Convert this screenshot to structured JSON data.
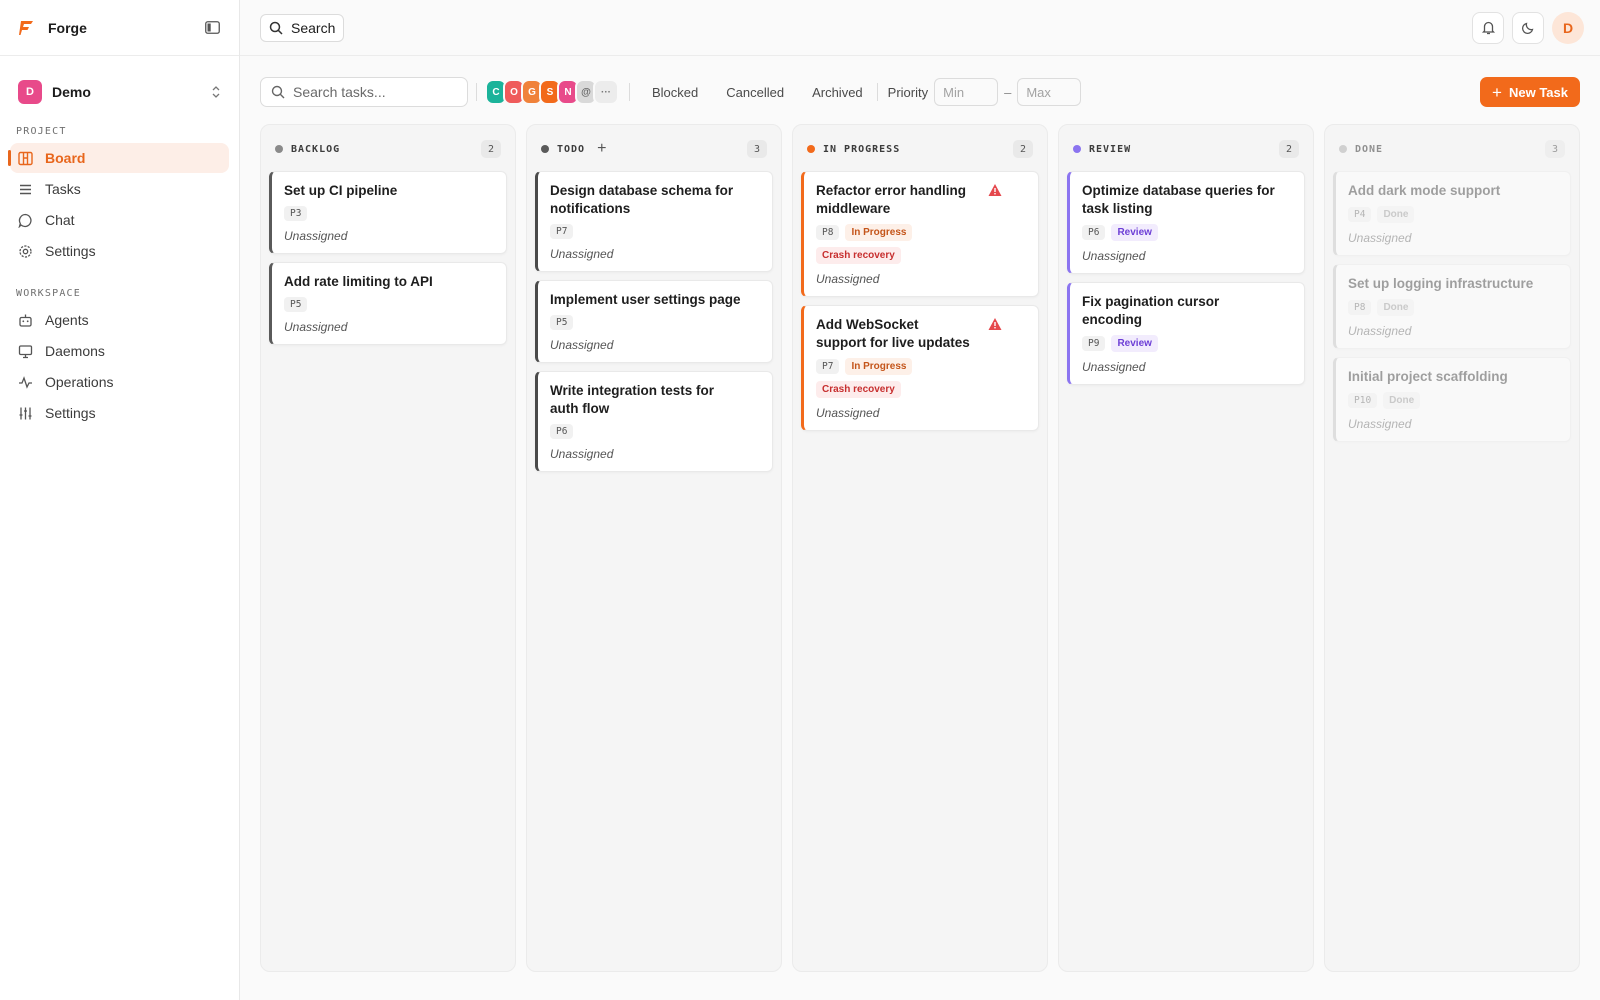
{
  "app": {
    "name": "Forge"
  },
  "project": {
    "initial": "D",
    "name": "Demo"
  },
  "sidebar": {
    "project_label": "PROJECT",
    "project_items": [
      {
        "label": "Board",
        "icon": "board-icon",
        "active": true
      },
      {
        "label": "Tasks",
        "icon": "list-icon"
      },
      {
        "label": "Chat",
        "icon": "chat-icon"
      },
      {
        "label": "Settings",
        "icon": "gear-icon"
      }
    ],
    "workspace_label": "WORKSPACE",
    "workspace_items": [
      {
        "label": "Agents",
        "icon": "robot-icon"
      },
      {
        "label": "Daemons",
        "icon": "monitor-icon"
      },
      {
        "label": "Operations",
        "icon": "activity-icon"
      },
      {
        "label": "Settings",
        "icon": "sliders-icon"
      }
    ]
  },
  "topbar": {
    "search_label": "Search",
    "user_initial": "D"
  },
  "filters": {
    "search_placeholder": "Search tasks...",
    "avatars": [
      {
        "initial": "C",
        "color": "#1bb39a"
      },
      {
        "initial": "O",
        "color": "#ef5b5b"
      },
      {
        "initial": "G",
        "color": "#f0823a"
      },
      {
        "initial": "S",
        "color": "#f26a1b"
      },
      {
        "initial": "N",
        "color": "#e84a8a"
      },
      {
        "initial": "@",
        "color": "#d9d9d9"
      }
    ],
    "more_label": "···",
    "blocked_label": "Blocked",
    "cancelled_label": "Cancelled",
    "archived_label": "Archived",
    "priority_label": "Priority",
    "min_placeholder": "Min",
    "dash": "–",
    "max_placeholder": "Max",
    "new_task_label": "New Task"
  },
  "colors": {
    "accent": "#f26a1b",
    "backlog": "#8a8a8a",
    "todo": "#5a5a5a",
    "in_progress": "#f26a1b",
    "review": "#8b74f0",
    "done": "#b3b3b3",
    "warning": "#e5484d"
  },
  "columns": [
    {
      "title": "BACKLOG",
      "count": "2",
      "dot": "#8a8a8a",
      "border": "#5a5a5a",
      "add": false,
      "cards": [
        {
          "title": "Set up CI pipeline",
          "priority": "P3",
          "assignee": "Unassigned"
        },
        {
          "title": "Add rate limiting to API",
          "priority": "P5",
          "assignee": "Unassigned"
        }
      ]
    },
    {
      "title": "TODO",
      "count": "3",
      "dot": "#5a5a5a",
      "border": "#4a4a4a",
      "add": true,
      "cards": [
        {
          "title": "Design database schema for notifications",
          "priority": "P7",
          "assignee": "Unassigned"
        },
        {
          "title": "Implement user settings page",
          "priority": "P5",
          "assignee": "Unassigned"
        },
        {
          "title": "Write integration tests for auth flow",
          "priority": "P6",
          "assignee": "Unassigned"
        }
      ]
    },
    {
      "title": "IN PROGRESS",
      "count": "2",
      "dot": "#f26a1b",
      "border": "#f26a1b",
      "add": false,
      "cards": [
        {
          "title": "Refactor error handling middleware",
          "priority": "P8",
          "status": "In Progress",
          "status_kind": "inprog",
          "flag": "Crash recovery",
          "warning": true,
          "assignee": "Unassigned"
        },
        {
          "title": "Add WebSocket support for live updates",
          "priority": "P7",
          "status": "In Progress",
          "status_kind": "inprog",
          "flag": "Crash recovery",
          "warning": true,
          "assignee": "Unassigned"
        }
      ]
    },
    {
      "title": "REVIEW",
      "count": "2",
      "dot": "#8b74f0",
      "border": "#8b74f0",
      "add": false,
      "cards": [
        {
          "title": "Optimize database queries for task listing",
          "priority": "P6",
          "status": "Review",
          "status_kind": "review",
          "assignee": "Unassigned"
        },
        {
          "title": "Fix pagination cursor encoding",
          "priority": "P9",
          "status": "Review",
          "status_kind": "review",
          "assignee": "Unassigned"
        }
      ]
    },
    {
      "title": "DONE",
      "count": "3",
      "dot": "#b3b3b3",
      "border": "#bdbdbd",
      "add": false,
      "faded": true,
      "cards": [
        {
          "title": "Add dark mode support",
          "priority": "P4",
          "status": "Done",
          "status_kind": "done",
          "assignee": "Unassigned"
        },
        {
          "title": "Set up logging infrastructure",
          "priority": "P8",
          "status": "Done",
          "status_kind": "done",
          "assignee": "Unassigned"
        },
        {
          "title": "Initial project scaffolding",
          "priority": "P10",
          "status": "Done",
          "status_kind": "done",
          "assignee": "Unassigned"
        }
      ]
    }
  ]
}
